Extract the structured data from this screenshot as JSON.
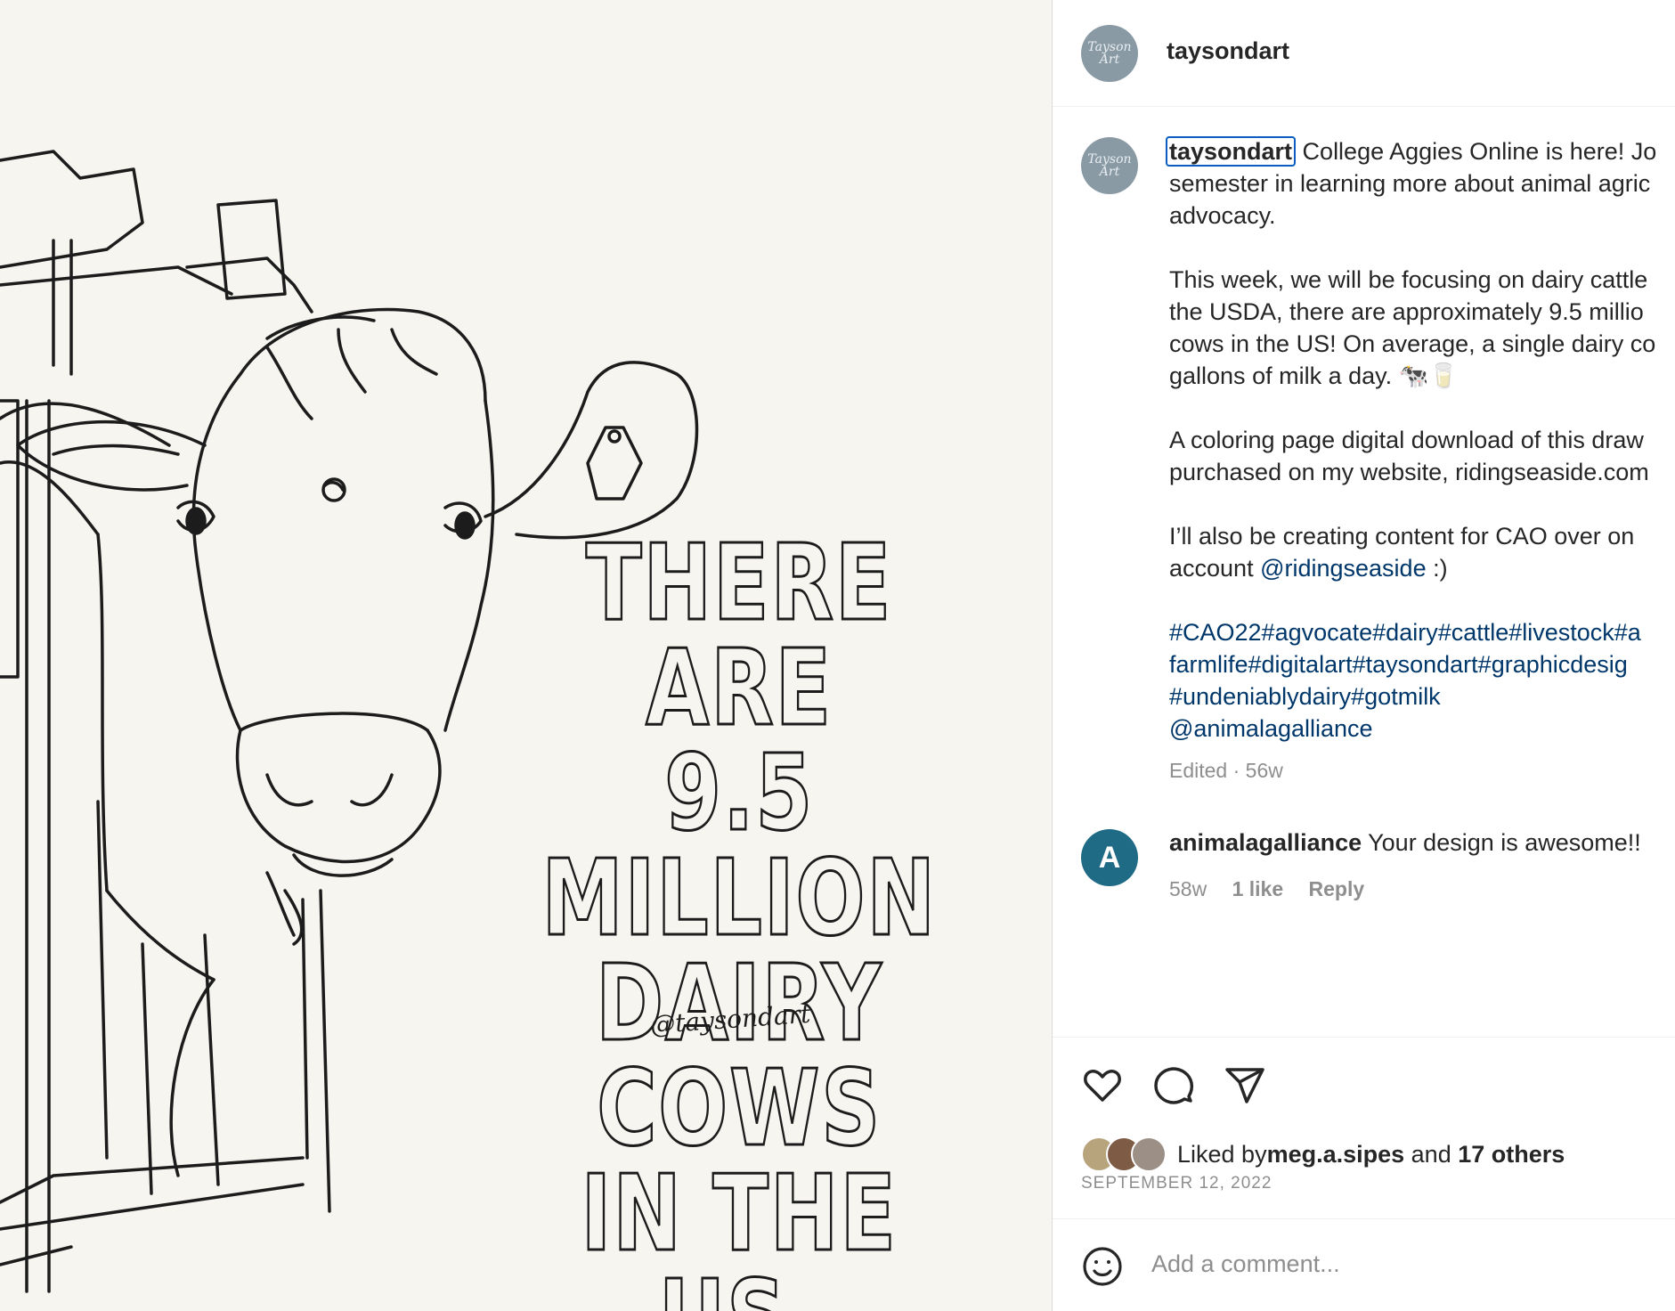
{
  "artwork": {
    "text_lines": [
      "THERE ARE",
      "9.5 MILLION",
      "DAIRY COWS",
      "IN THE US."
    ],
    "handle": "@taysondart"
  },
  "header": {
    "avatar_text": "Tayson Art",
    "username": "taysondart"
  },
  "caption": {
    "username": "taysondart",
    "p1": " College Aggies Online is here! Jo\nsemester in learning more about animal agric\nadvocacy.",
    "p2": "This week, we will be focusing on dairy cattle\nthe USDA, there are approximately 9.5 millio\ncows in the US! On average, a single dairy co\ngallons of milk a day. 🐄🥛",
    "p3": "A coloring page digital download of this draw\npurchased on my website, ridingseaside.com",
    "p4_a": "I’ll also be creating content for CAO over on\naccount ",
    "p4_mention": "@ridingseaside",
    "p4_b": " :)",
    "tags": "#CAO22#agvocate#dairy#cattle#livestock#a\nfarmlife#digitalart#taysondart#graphicdesig\n#undeniablydairy#gotmilk\n@animalagalliance",
    "edited": "Edited · 56w"
  },
  "comment": {
    "avatar_text": "A",
    "username": "animalagalliance",
    "text": "Your design is awesome!!",
    "time": "58w",
    "likes": "1 like",
    "reply": "Reply"
  },
  "actions": {
    "like_icon": "heart-icon",
    "comment_icon": "comment-icon",
    "share_icon": "share-icon"
  },
  "likes": {
    "prefix": "Liked by ",
    "user": "meg.a.sipes",
    "middle": " and ",
    "others": "17 others"
  },
  "date": "SEPTEMBER 12, 2022",
  "add_comment": {
    "placeholder": "Add a comment..."
  },
  "colors": {
    "link": "#00376b",
    "muted": "#8e8e8e",
    "art_bg": "#f6f5ef",
    "focus_ring": "#0a5ebf"
  }
}
